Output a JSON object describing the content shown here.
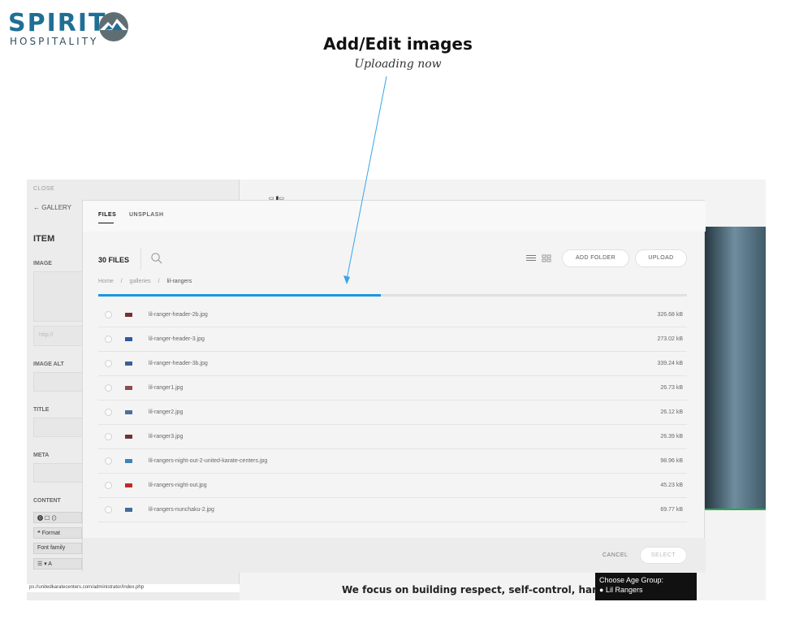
{
  "branding": {
    "logo_top": "SPIRIT",
    "logo_bottom": "HOSPITALITY",
    "headline": "Add/Edit images",
    "subline": "Uploading now"
  },
  "editor": {
    "close": "CLOSE",
    "gallery": "GALLERY",
    "item_title": "ITEM",
    "image_label": "IMAGE",
    "http_placeholder": "http://",
    "image_alt_label": "IMAGE ALT",
    "title_label": "TITLE",
    "meta_label": "META",
    "content_label": "CONTENT",
    "format": "Format",
    "font_family": "Font family",
    "status_url": "ps://unitedkaratecenters.com/administrator/index.php"
  },
  "preview": {
    "tagline": "We focus on building respect, self-control, hand-eye",
    "age_title": "Choose Age Group:",
    "age_option": "Lil Rangers"
  },
  "modal": {
    "tabs": [
      "FILES",
      "UNSPLASH"
    ],
    "files_count": "30 FILES",
    "buttons": {
      "add_folder": "ADD FOLDER",
      "upload": "UPLOAD",
      "cancel": "CANCEL",
      "select": "SELECT"
    },
    "breadcrumb": [
      "Home",
      "/",
      "galleries",
      "/",
      "lil-rangers"
    ],
    "upload_progress": 0.48,
    "files": [
      {
        "name": "lil-ranger-header-2b.jpg",
        "size": "326.68 kB",
        "thumb": "#7a2f2f"
      },
      {
        "name": "lil-ranger-header-3.jpg",
        "size": "273.02 kB",
        "thumb": "#2f5aa1"
      },
      {
        "name": "lil-ranger-header-3b.jpg",
        "size": "339.24 kB",
        "thumb": "#3b5f95"
      },
      {
        "name": "lil-ranger1.jpg",
        "size": "26.73 kB",
        "thumb": "#8c4b4b"
      },
      {
        "name": "lil-ranger2.jpg",
        "size": "26.12 kB",
        "thumb": "#4d6f9e"
      },
      {
        "name": "lil-ranger3.jpg",
        "size": "26.39 kB",
        "thumb": "#6d3434"
      },
      {
        "name": "lil-rangers-night-out-2-united-karate-centers.jpg",
        "size": "98.96 kB",
        "thumb": "#3d84b3"
      },
      {
        "name": "lil-rangers-night-out.jpg",
        "size": "45.23 kB",
        "thumb": "#c12a2a"
      },
      {
        "name": "lil-rangers-nunchaku-2.jpg",
        "size": "69.77 kB",
        "thumb": "#426c9c"
      }
    ]
  },
  "colors": {
    "accent": "#1d97dd",
    "logo_blue": "#1f6f95"
  }
}
